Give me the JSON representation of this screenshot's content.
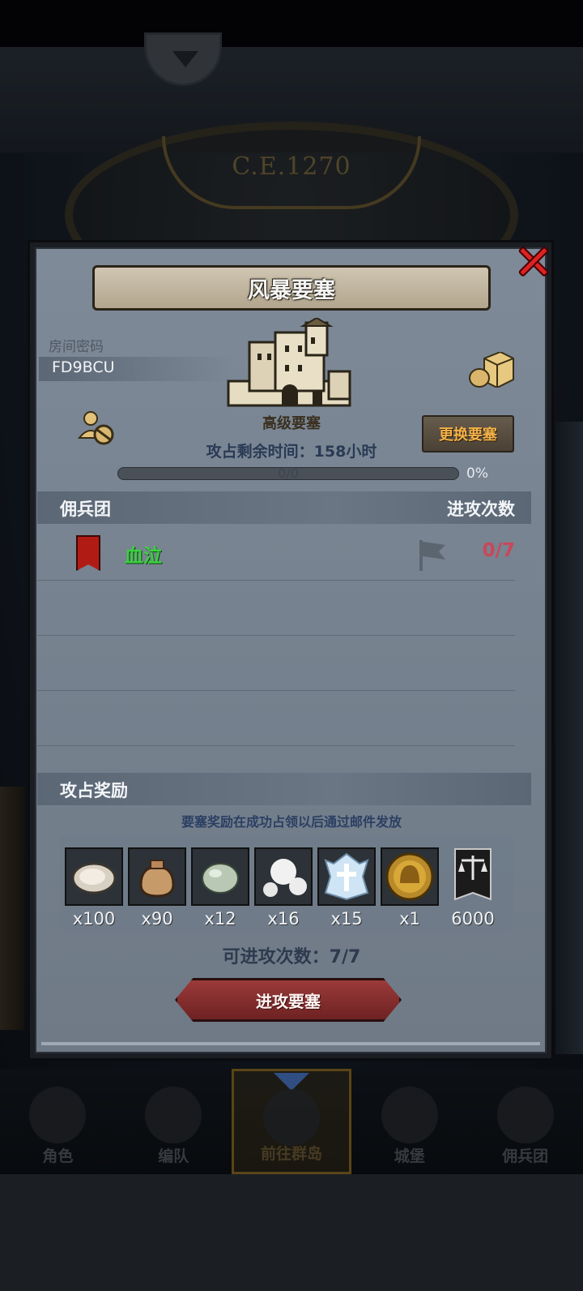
{
  "scene": {
    "era": "C.E.1270"
  },
  "modal": {
    "title": "风暴要塞",
    "room_label": "房间密码",
    "room_code": "FD9BCU",
    "fort_name": "高级要塞",
    "change_button": "更换要塞",
    "time_left": "攻占剩余时间：158小时",
    "progress": {
      "text": "0/0",
      "percent_label": "0%",
      "fraction": 0
    },
    "mercenary_section": {
      "title": "佣兵团",
      "attack_count_header": "进攻次数",
      "rows": [
        {
          "name": "血泣",
          "attack_count": "0/7",
          "banner_color": "#b01c14"
        }
      ]
    },
    "reward_section": {
      "title": "攻占奖励",
      "note": "要塞奖励在成功占领以后通过邮件发放",
      "items": [
        {
          "icon": "oyster-icon",
          "qty": "x100"
        },
        {
          "icon": "pouch-icon",
          "qty": "x90"
        },
        {
          "icon": "pale-gem-icon",
          "qty": "x12"
        },
        {
          "icon": "pearls-icon",
          "qty": "x16"
        },
        {
          "icon": "crystal-emblem-icon",
          "qty": "x15"
        },
        {
          "icon": "gold-helmet-medal-icon",
          "qty": "x1"
        },
        {
          "icon": "justice-banner-icon",
          "qty": "6000"
        }
      ]
    },
    "attempts": "可进攻次数：7/7",
    "attack_button": "进攻要塞"
  },
  "bottom_nav": {
    "items": [
      {
        "label": "角色",
        "icon": "knight-icon",
        "active": false
      },
      {
        "label": "编队",
        "icon": "soldier-icon",
        "active": false
      },
      {
        "label": "前往群岛",
        "icon": "island-compass-icon",
        "active": true
      },
      {
        "label": "城堡",
        "icon": "castle-icon",
        "active": false
      },
      {
        "label": "佣兵团",
        "icon": "ship-icon",
        "active": false
      }
    ]
  },
  "colors": {
    "panel": "#7e8a98",
    "accent_orange": "#f2b24a",
    "mercenary_green": "#39d23e",
    "count_red": "#c9475a",
    "attack_button": "#8a2e2e"
  }
}
